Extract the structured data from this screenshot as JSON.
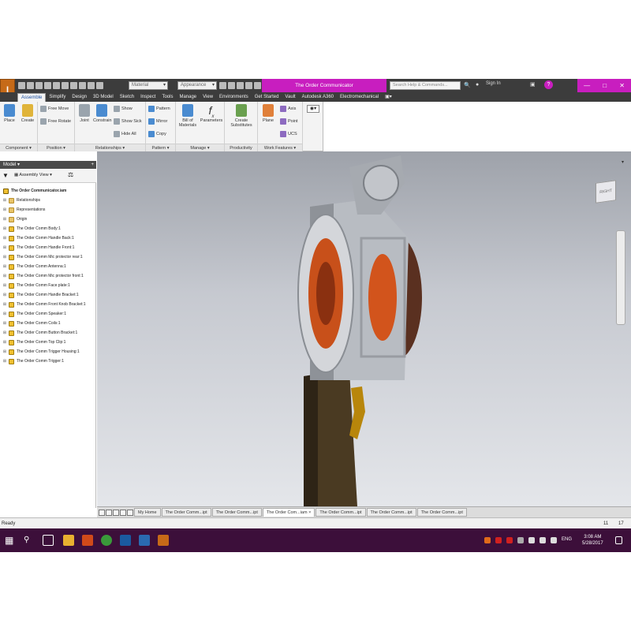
{
  "title_bar": {
    "logo_letter": "I",
    "material_placeholder": "Material",
    "appearance_placeholder": "Appearance",
    "document_title": "The Order Communicator",
    "help_search_placeholder": "Search Help & Commands...",
    "sign_in": "Sign In",
    "accent_color": "#c81ebf"
  },
  "ribbon_tabs": [
    "Assemble",
    "Simplify",
    "Design",
    "3D Model",
    "Sketch",
    "Inspect",
    "Tools",
    "Manage",
    "View",
    "Environments",
    "Get Started",
    "Vault",
    "Autodesk A360",
    "Electromechanical"
  ],
  "ribbon_groups": {
    "component": {
      "label": "Component",
      "place": "Place",
      "create": "Create"
    },
    "position": {
      "label": "Position",
      "free_move": "Free Move",
      "free_rotate": "Free Rotate"
    },
    "relationships": {
      "label": "Relationships",
      "joint": "Joint",
      "constrain": "Constrain",
      "show": "Show",
      "show_sick": "Show Sick",
      "hide_all": "Hide All"
    },
    "pattern": {
      "label": "Pattern",
      "pattern": "Pattern",
      "mirror": "Mirror",
      "copy": "Copy"
    },
    "manage": {
      "label": "Manage",
      "bill_line1": "Bill of",
      "bill_line2": "Materials",
      "parameters": "Parameters"
    },
    "productivity": {
      "label": "Productivity",
      "create_line1": "Create",
      "create_line2": "Substitutes"
    },
    "work_features": {
      "label": "Work Features",
      "plane": "Plane",
      "axis": "Axis",
      "point": "Point",
      "ucs": "UCS"
    }
  },
  "browser": {
    "header": "Model",
    "view_label": "Assembly View",
    "root": "The Order Communicator.iam",
    "items": [
      {
        "label": "Relationships",
        "icon": "folder-icon"
      },
      {
        "label": "Representations",
        "icon": "folder-icon"
      },
      {
        "label": "Origin",
        "icon": "folder-icon"
      },
      {
        "label": "The Order Comm Body:1",
        "icon": "part-icon"
      },
      {
        "label": "The Order Comm Handle Back:1",
        "icon": "part-icon"
      },
      {
        "label": "The Order Comm Handle Front:1",
        "icon": "part-icon"
      },
      {
        "label": "The Order Comm Mic protector rear:1",
        "icon": "part-icon"
      },
      {
        "label": "The Order Comm Antenna:1",
        "icon": "part-icon"
      },
      {
        "label": "The Order Comm Mic protector front:1",
        "icon": "part-icon"
      },
      {
        "label": "The Order Comm Face plate:1",
        "icon": "part-icon"
      },
      {
        "label": "The Order Comm Handle Bracket:1",
        "icon": "part-icon"
      },
      {
        "label": "The Order Comm Front Knob Bracket:1",
        "icon": "part-icon"
      },
      {
        "label": "The Order Comm Speaker:1",
        "icon": "part-icon"
      },
      {
        "label": "The Order Comm Coils:1",
        "icon": "part-icon"
      },
      {
        "label": "The Order Comm Button Bracket:1",
        "icon": "part-icon"
      },
      {
        "label": "The Order Comm Top Clip:1",
        "icon": "part-icon"
      },
      {
        "label": "The Order Comm Trigger Housing:1",
        "icon": "part-icon"
      },
      {
        "label": "The Order Comm Trigger:1",
        "icon": "part-icon"
      }
    ]
  },
  "viewcube_label": "RIGHT",
  "document_tabs": [
    {
      "label": "My Home",
      "active": false
    },
    {
      "label": "The Order Comm...ipt",
      "active": false
    },
    {
      "label": "The Order Comm...ipt",
      "active": false
    },
    {
      "label": "The Order Com...iam",
      "active": true
    },
    {
      "label": "The Order Comm...ipt",
      "active": false
    },
    {
      "label": "The Order Comm...ipt",
      "active": false
    },
    {
      "label": "The Order Comm...ipt",
      "active": false
    }
  ],
  "status": {
    "text": "Ready",
    "count1": "11",
    "count2": "17"
  },
  "taskbar": {
    "lang": "ENG",
    "time": "3:08 AM",
    "date": "5/28/2017"
  }
}
